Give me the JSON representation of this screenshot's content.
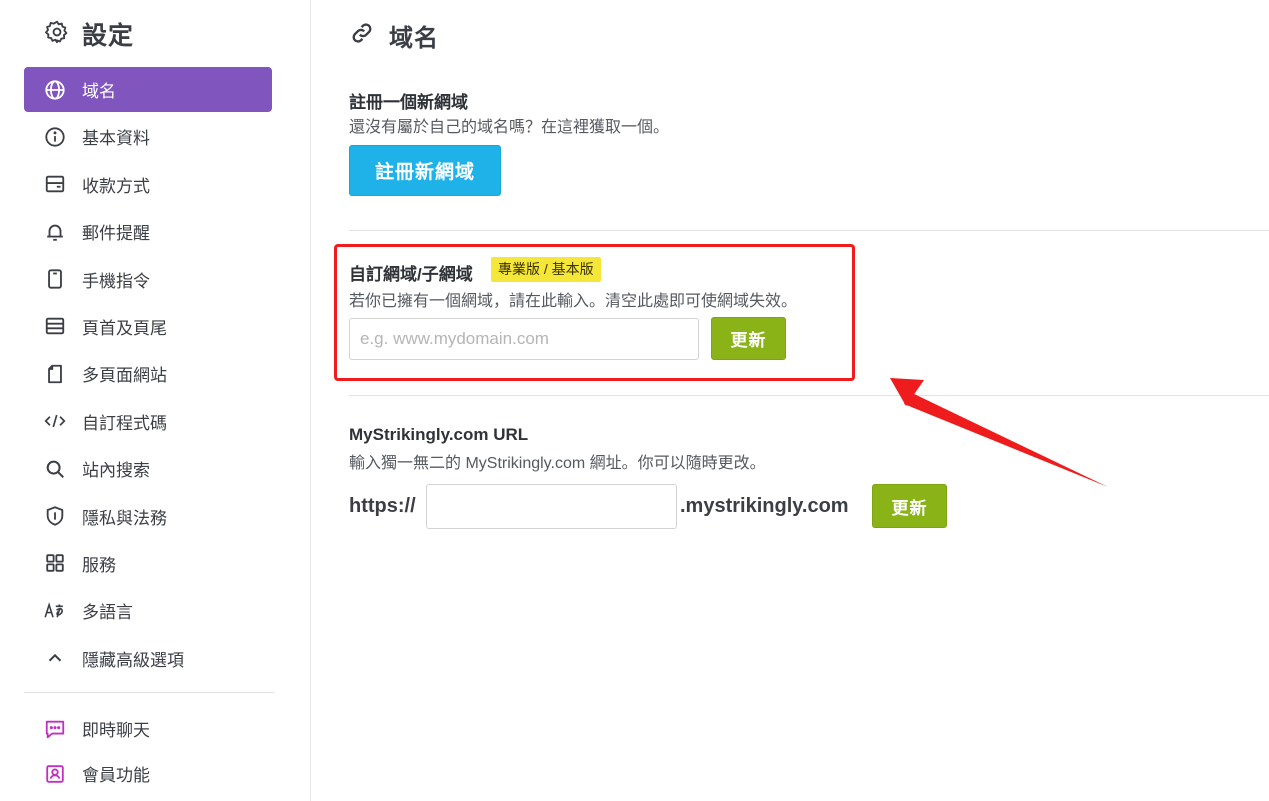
{
  "sidebar": {
    "title": "設定",
    "title_icon": "gear-icon",
    "items": [
      {
        "label": "域名",
        "icon": "globe-icon",
        "active": true
      },
      {
        "label": "基本資料",
        "icon": "info-icon"
      },
      {
        "label": "收款方式",
        "icon": "wallet-icon"
      },
      {
        "label": "郵件提醒",
        "icon": "bell-icon"
      },
      {
        "label": "手機指令",
        "icon": "mobile-icon"
      },
      {
        "label": "頁首及頁尾",
        "icon": "layout-icon"
      },
      {
        "label": "多頁面網站",
        "icon": "pages-icon"
      },
      {
        "label": "自訂程式碼",
        "icon": "code-icon"
      },
      {
        "label": "站內搜索",
        "icon": "search-icon"
      },
      {
        "label": "隱私與法務",
        "icon": "shield-icon"
      },
      {
        "label": "服務",
        "icon": "grid-icon"
      },
      {
        "label": "多語言",
        "icon": "language-icon"
      },
      {
        "label": "隱藏高級選項",
        "icon": "chevron-up-icon"
      }
    ],
    "extra_items": [
      {
        "label": "即時聊天",
        "icon": "chat-icon",
        "color": "#c030c0"
      },
      {
        "label": "會員功能",
        "icon": "member-icon",
        "color": "#c030c0"
      }
    ],
    "active_color": "#8055be"
  },
  "main": {
    "title": "域名",
    "title_icon": "link-icon",
    "register": {
      "title": "註冊一個新網域",
      "description": "還沒有屬於自己的域名嗎？在這裡獲取一個。",
      "button_label": "註冊新網域"
    },
    "custom_domain": {
      "title": "自訂網域/子網域",
      "badge": "專業版 / 基本版",
      "description": "若你已擁有一個網域，請在此輸入。清空此處即可使網域失效。",
      "input_placeholder": "e.g. www.mydomain.com",
      "input_value": "",
      "button_label": "更新"
    },
    "mystrikingly": {
      "title": "MyStrikingly.com URL",
      "description": "輸入獨一無二的 MyStrikingly.com 網址。你可以隨時更改。",
      "prefix": "https://",
      "input_value": "",
      "suffix": ".mystrikingly.com",
      "button_label": "更新"
    }
  },
  "colors": {
    "blue_button": "#1fb2e8",
    "green_button": "#8ab317",
    "badge": "#f5e63a",
    "annotation_red": "#ee1c1c"
  }
}
